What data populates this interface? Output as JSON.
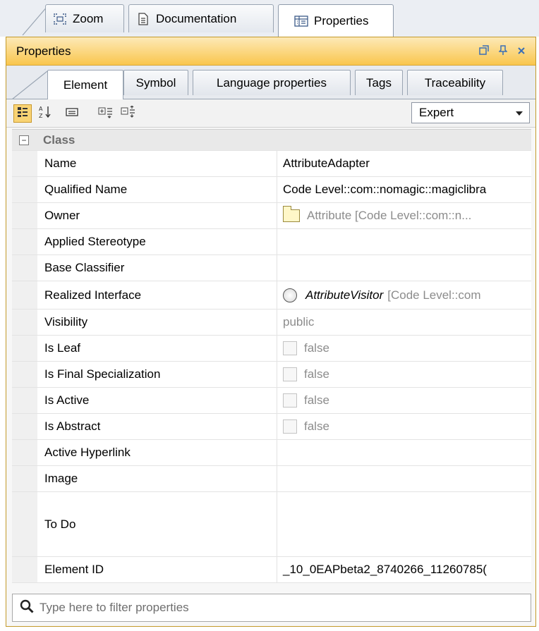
{
  "top_tabs": [
    {
      "label": "Zoom",
      "icon": "zoom-icon"
    },
    {
      "label": "Documentation",
      "icon": "document-icon"
    },
    {
      "label": "Properties",
      "icon": "properties-icon"
    }
  ],
  "panel": {
    "title": "Properties",
    "buttons": [
      "restore-icon",
      "pin-icon",
      "close-icon"
    ]
  },
  "sub_tabs": [
    "Element",
    "Symbol",
    "Language properties",
    "Tags",
    "Traceability"
  ],
  "toolbar": {
    "mode": "Expert"
  },
  "grid": {
    "category": "Class",
    "rows": [
      {
        "key": "Name",
        "value": "AttributeAdapter"
      },
      {
        "key": "Qualified Name",
        "value": "Code Level::com::nomagic::magiclibra"
      },
      {
        "key": "Owner",
        "value": "Attribute [Code Level::com::n..."
      },
      {
        "key": "Applied Stereotype",
        "value": ""
      },
      {
        "key": "Base Classifier",
        "value": ""
      },
      {
        "key": "Realized Interface",
        "value_italic": "AttributeVisitor",
        "value": "[Code Level::com"
      },
      {
        "key": "Visibility",
        "value": "public"
      },
      {
        "key": "Is Leaf",
        "value": "false"
      },
      {
        "key": "Is Final Specialization",
        "value": "false"
      },
      {
        "key": "Is Active",
        "value": "false"
      },
      {
        "key": "Is Abstract",
        "value": "false"
      },
      {
        "key": "Active Hyperlink",
        "value": ""
      },
      {
        "key": "Image",
        "value": ""
      },
      {
        "key": "To Do",
        "value": ""
      },
      {
        "key": "Element ID",
        "value": "_10_0EAPbeta2_8740266_11260785("
      }
    ]
  },
  "filter": {
    "placeholder": "Type here to filter properties"
  }
}
